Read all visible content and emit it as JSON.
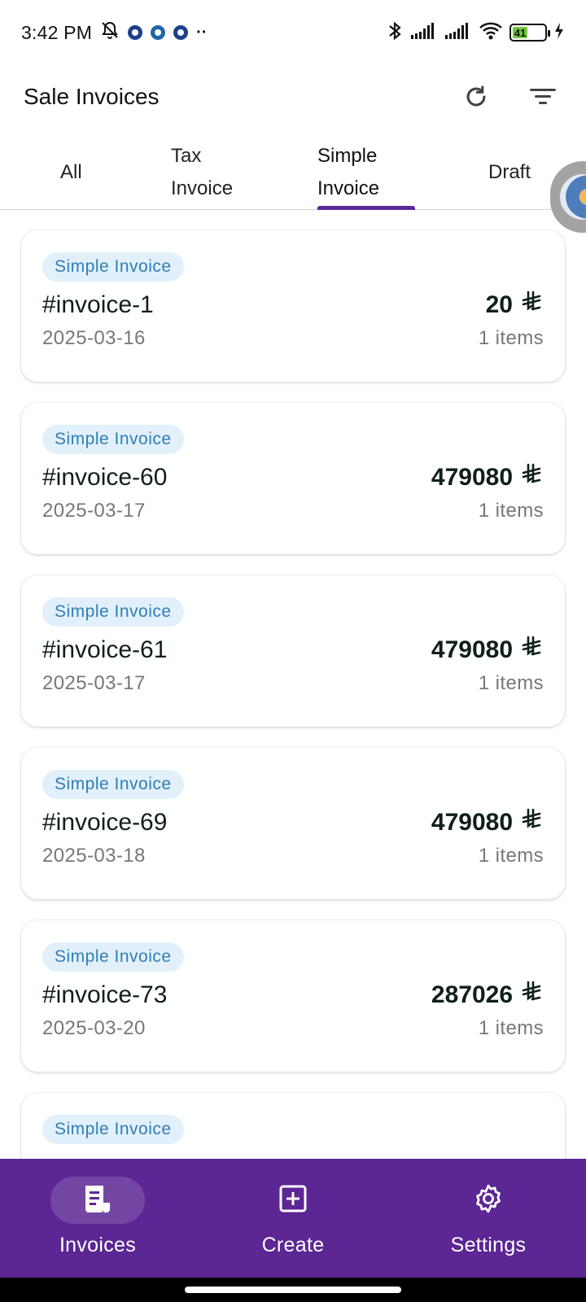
{
  "status_bar": {
    "time": "3:42 PM",
    "battery_level": "41"
  },
  "header": {
    "title": "Sale Invoices",
    "refresh_icon": "refresh-icon",
    "filter_icon": "filter-icon"
  },
  "tabs": [
    {
      "line1": "All",
      "line2": ""
    },
    {
      "line1": "Tax",
      "line2": "Invoice"
    },
    {
      "line1": "Simple",
      "line2": "Invoice"
    },
    {
      "line1": "Draft",
      "line2": ""
    }
  ],
  "active_tab": 2,
  "currency_icon": "saudi-riyal-icon",
  "invoices": [
    {
      "badge": "Simple Invoice",
      "id": "#invoice-1",
      "amount": "20",
      "date": "2025-03-16",
      "items": "1 items"
    },
    {
      "badge": "Simple Invoice",
      "id": "#invoice-60",
      "amount": "479080",
      "date": "2025-03-17",
      "items": "1 items"
    },
    {
      "badge": "Simple Invoice",
      "id": "#invoice-61",
      "amount": "479080",
      "date": "2025-03-17",
      "items": "1 items"
    },
    {
      "badge": "Simple Invoice",
      "id": "#invoice-69",
      "amount": "479080",
      "date": "2025-03-18",
      "items": "1 items"
    },
    {
      "badge": "Simple Invoice",
      "id": "#invoice-73",
      "amount": "287026",
      "date": "2025-03-20",
      "items": "1 items"
    },
    {
      "badge": "Simple Invoice",
      "id": "",
      "amount": "",
      "date": "",
      "items": ""
    }
  ],
  "bottom_nav": [
    {
      "label": "Invoices",
      "icon": "invoice-icon"
    },
    {
      "label": "Create",
      "icon": "add-box-icon"
    },
    {
      "label": "Settings",
      "icon": "gear-icon"
    }
  ],
  "colors": {
    "brand": "#5c2694",
    "badge_bg": "#e2f0fb",
    "badge_text": "#2f7fb4"
  }
}
